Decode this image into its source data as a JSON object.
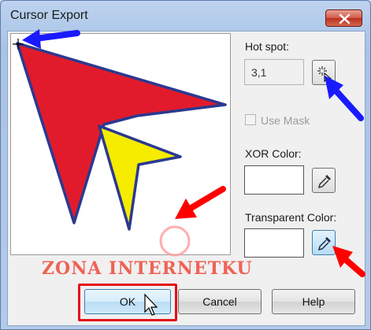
{
  "window": {
    "title": "Cursor Export"
  },
  "hotspot": {
    "label": "Hot spot:",
    "value": "3,1",
    "pick_icon": "hotspot-picker-icon"
  },
  "use_mask": {
    "label": "Use Mask",
    "checked": false,
    "enabled": false
  },
  "xor_color": {
    "label": "XOR Color:",
    "value": "#ffffff",
    "picker_icon": "eyedropper-icon"
  },
  "transparent_color": {
    "label": "Transparent Color:",
    "value": "#ffffff",
    "picker_icon": "eyedropper-icon"
  },
  "buttons": {
    "ok": "OK",
    "cancel": "Cancel",
    "help": "Help"
  },
  "watermark": "ZONA INTERNETKU",
  "preview": {
    "cursor_colors": {
      "large_arrow": "#e21b2c",
      "small_arrow": "#f5ec00",
      "outline": "#2b3990"
    }
  },
  "annotations": {
    "arrow_color_blue": "#1a1aff",
    "arrow_color_red": "#ff0000"
  }
}
